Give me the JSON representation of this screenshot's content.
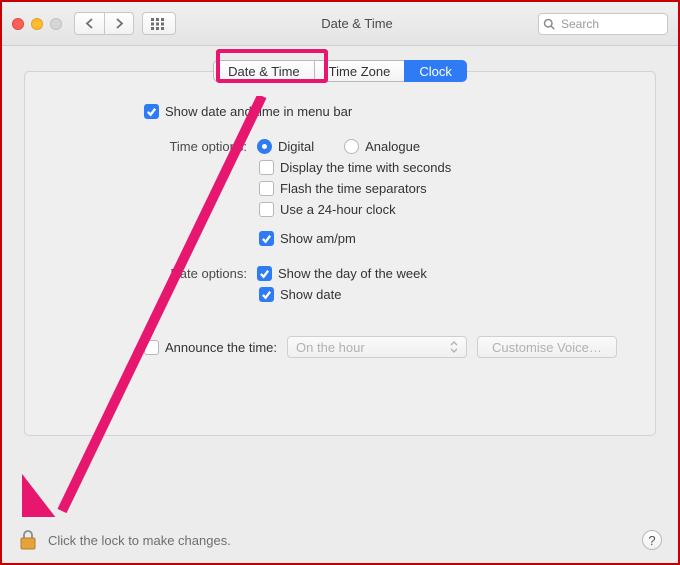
{
  "window": {
    "title": "Date & Time"
  },
  "search": {
    "placeholder": "Search"
  },
  "tabs": [
    {
      "label": "Date & Time",
      "selected": false
    },
    {
      "label": "Time Zone",
      "selected": false
    },
    {
      "label": "Clock",
      "selected": true
    }
  ],
  "options": {
    "show_in_menu_bar": {
      "label": "Show date and time in menu bar",
      "checked": true
    },
    "time_options_label": "Time options:",
    "time_format_digital": {
      "label": "Digital",
      "selected": true
    },
    "time_format_analogue": {
      "label": "Analogue",
      "selected": false
    },
    "display_seconds": {
      "label": "Display the time with seconds",
      "checked": false
    },
    "flash_separators": {
      "label": "Flash the time separators",
      "checked": false
    },
    "use_24_hour": {
      "label": "Use a 24-hour clock",
      "checked": false
    },
    "show_ampm": {
      "label": "Show am/pm",
      "checked": true
    },
    "date_options_label": "Date options:",
    "show_day_of_week": {
      "label": "Show the day of the week",
      "checked": true
    },
    "show_date": {
      "label": "Show date",
      "checked": true
    },
    "announce": {
      "label": "Announce the time:",
      "checked": false
    },
    "announce_interval": {
      "value": "On the hour"
    },
    "customise_voice": {
      "label": "Customise Voice…"
    }
  },
  "footer": {
    "lock_hint": "Click the lock to make changes.",
    "help": "?"
  },
  "annotation_highlight": {
    "target_tab": "Date & Time"
  }
}
